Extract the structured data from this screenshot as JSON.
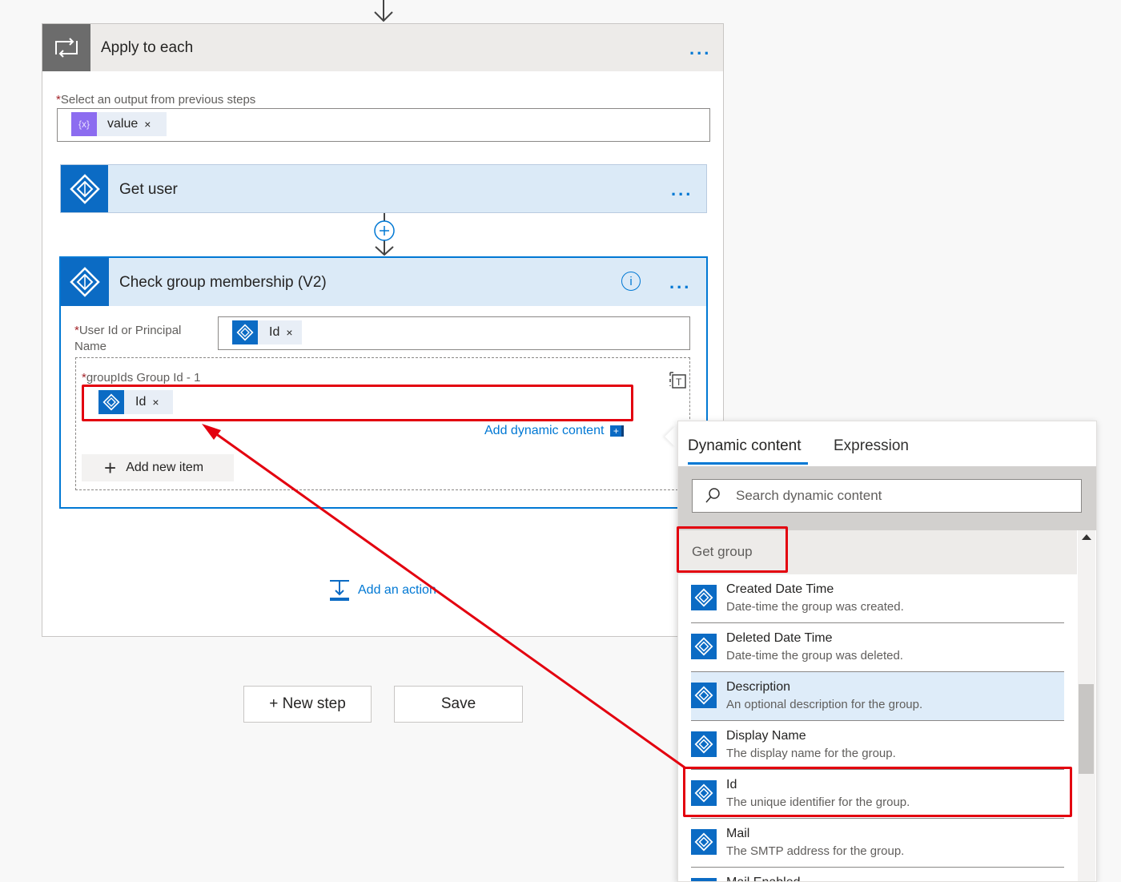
{
  "apply_to_each": {
    "title": "Apply to each",
    "more_label": "...",
    "select_label": "Select an output from previous steps",
    "required_mark": "*",
    "token": {
      "label": "value",
      "remove": "×",
      "icon": "expression-icon"
    }
  },
  "get_user": {
    "title": "Get user",
    "more_label": "..."
  },
  "check_group": {
    "title": "Check group membership (V2)",
    "info_label": "i",
    "more_label": "...",
    "user_id_label": "User Id or Principal Name",
    "user_id_token": {
      "label": "Id",
      "remove": "×"
    },
    "group_ids_label": "groupIds Group Id - 1",
    "group_id_token": {
      "label": "Id",
      "remove": "×"
    },
    "add_dynamic": "Add dynamic content",
    "add_new_item": "Add new item"
  },
  "add_action": "Add an action",
  "footer": {
    "new_step": "+ New step",
    "save": "Save"
  },
  "dynamic_panel": {
    "tabs": [
      {
        "label": "Dynamic content",
        "active": true
      },
      {
        "label": "Expression",
        "active": false
      }
    ],
    "search_placeholder": "Search dynamic content",
    "section": "Get group",
    "items": [
      {
        "title": "Created Date Time",
        "desc": "Date-time the group was created."
      },
      {
        "title": "Deleted Date Time",
        "desc": "Date-time the group was deleted."
      },
      {
        "title": "Description",
        "desc": "An optional description for the group."
      },
      {
        "title": "Display Name",
        "desc": "The display name for the group."
      },
      {
        "title": "Id",
        "desc": "The unique identifier for the group."
      },
      {
        "title": "Mail",
        "desc": "The SMTP address for the group."
      },
      {
        "title": "Mail Enabled",
        "desc": ""
      }
    ]
  },
  "colors": {
    "accent": "#0078d4",
    "azure_ad": "#0b6bc4",
    "highlight": "#e3000f",
    "loop_gray": "#6c6c6c",
    "token_purple": "#8c6cf0"
  }
}
